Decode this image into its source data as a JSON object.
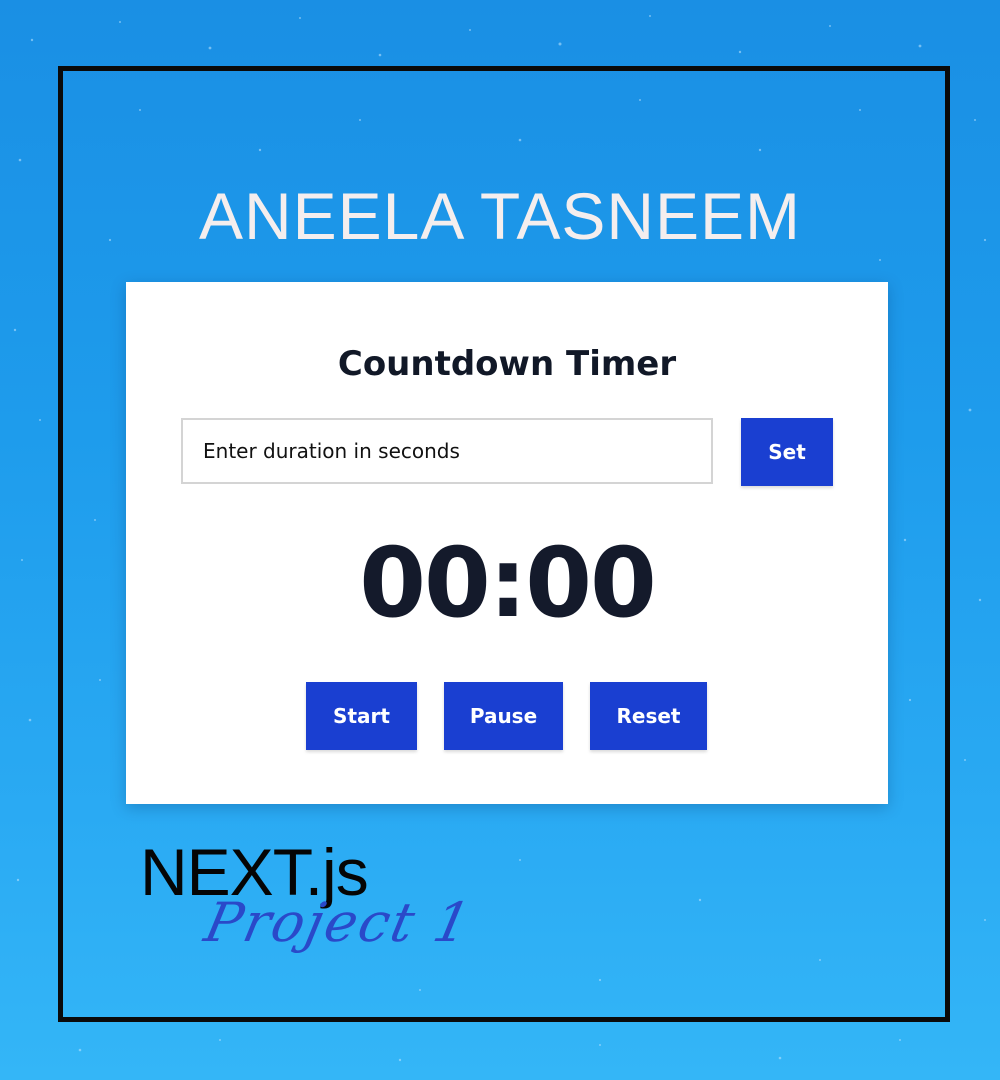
{
  "header": {
    "author_name": "ANEELA TASNEEM"
  },
  "timer_card": {
    "title": "Countdown Timer",
    "duration_input": {
      "value": "",
      "placeholder": "Enter duration in seconds"
    },
    "set_button_label": "Set",
    "display_time": "00:00",
    "controls": {
      "start_label": "Start",
      "pause_label": "Pause",
      "reset_label": "Reset"
    }
  },
  "footer": {
    "framework_label": "NEXT.js",
    "project_label": "Project 1"
  },
  "colors": {
    "background": "#1e9cec",
    "button": "#1a3fd1",
    "card": "#ffffff",
    "timer_text": "#141a2b",
    "author_text": "#f4eeee",
    "project_text": "#2a49c9"
  }
}
